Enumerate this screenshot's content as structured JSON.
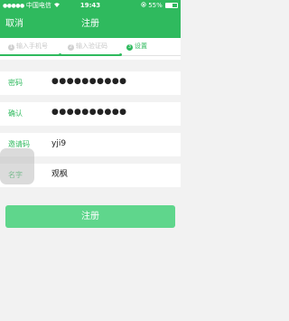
{
  "status": {
    "signal": "●●●●●",
    "carrier": "中国电信",
    "wifi_icon": "wifi-icon",
    "time": "19:43",
    "battery_percent": "55%",
    "battery_level": 0.55
  },
  "nav": {
    "back_label": "取消",
    "title": "注册"
  },
  "stepper": {
    "steps": [
      {
        "number": "1",
        "label": "输入手机号",
        "state": "done"
      },
      {
        "number": "2",
        "label": "输入验证码",
        "state": "done"
      },
      {
        "number": "3",
        "label": "设置",
        "state": "active"
      }
    ],
    "progress": 0.67
  },
  "form": {
    "password": {
      "label": "密码",
      "value": "●●●●●●●●●●"
    },
    "confirm": {
      "label": "确认",
      "value": "●●●●●●●●●●"
    },
    "invite": {
      "label": "邀请码",
      "value": "yji9"
    },
    "name": {
      "label": "名字",
      "value": "观枫"
    }
  },
  "submit_label": "注册",
  "colors": {
    "brand_green": "#2fba5e",
    "button_green": "#5fd68c",
    "background": "#f2f2f2"
  }
}
